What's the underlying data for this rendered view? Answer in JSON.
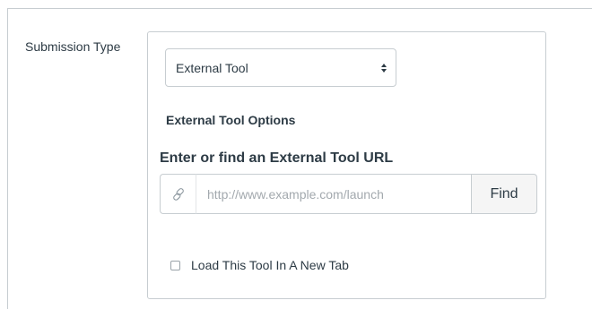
{
  "submission": {
    "label": "Submission Type",
    "selected_type": "External Tool"
  },
  "external_tool": {
    "options_heading": "External Tool Options",
    "url_heading": "Enter or find an External Tool URL",
    "url_placeholder": "http://www.example.com/launch",
    "url_value": "",
    "find_label": "Find",
    "new_tab_label": "Load This Tool In A New Tab",
    "new_tab_checked": false
  },
  "icons": {
    "link": "link-icon",
    "select_arrows": "chevron-updown-icon"
  },
  "colors": {
    "border": "#c7cdd1",
    "text": "#2d3b45",
    "placeholder": "#a3a9ae",
    "button_bg": "#f5f5f5"
  }
}
